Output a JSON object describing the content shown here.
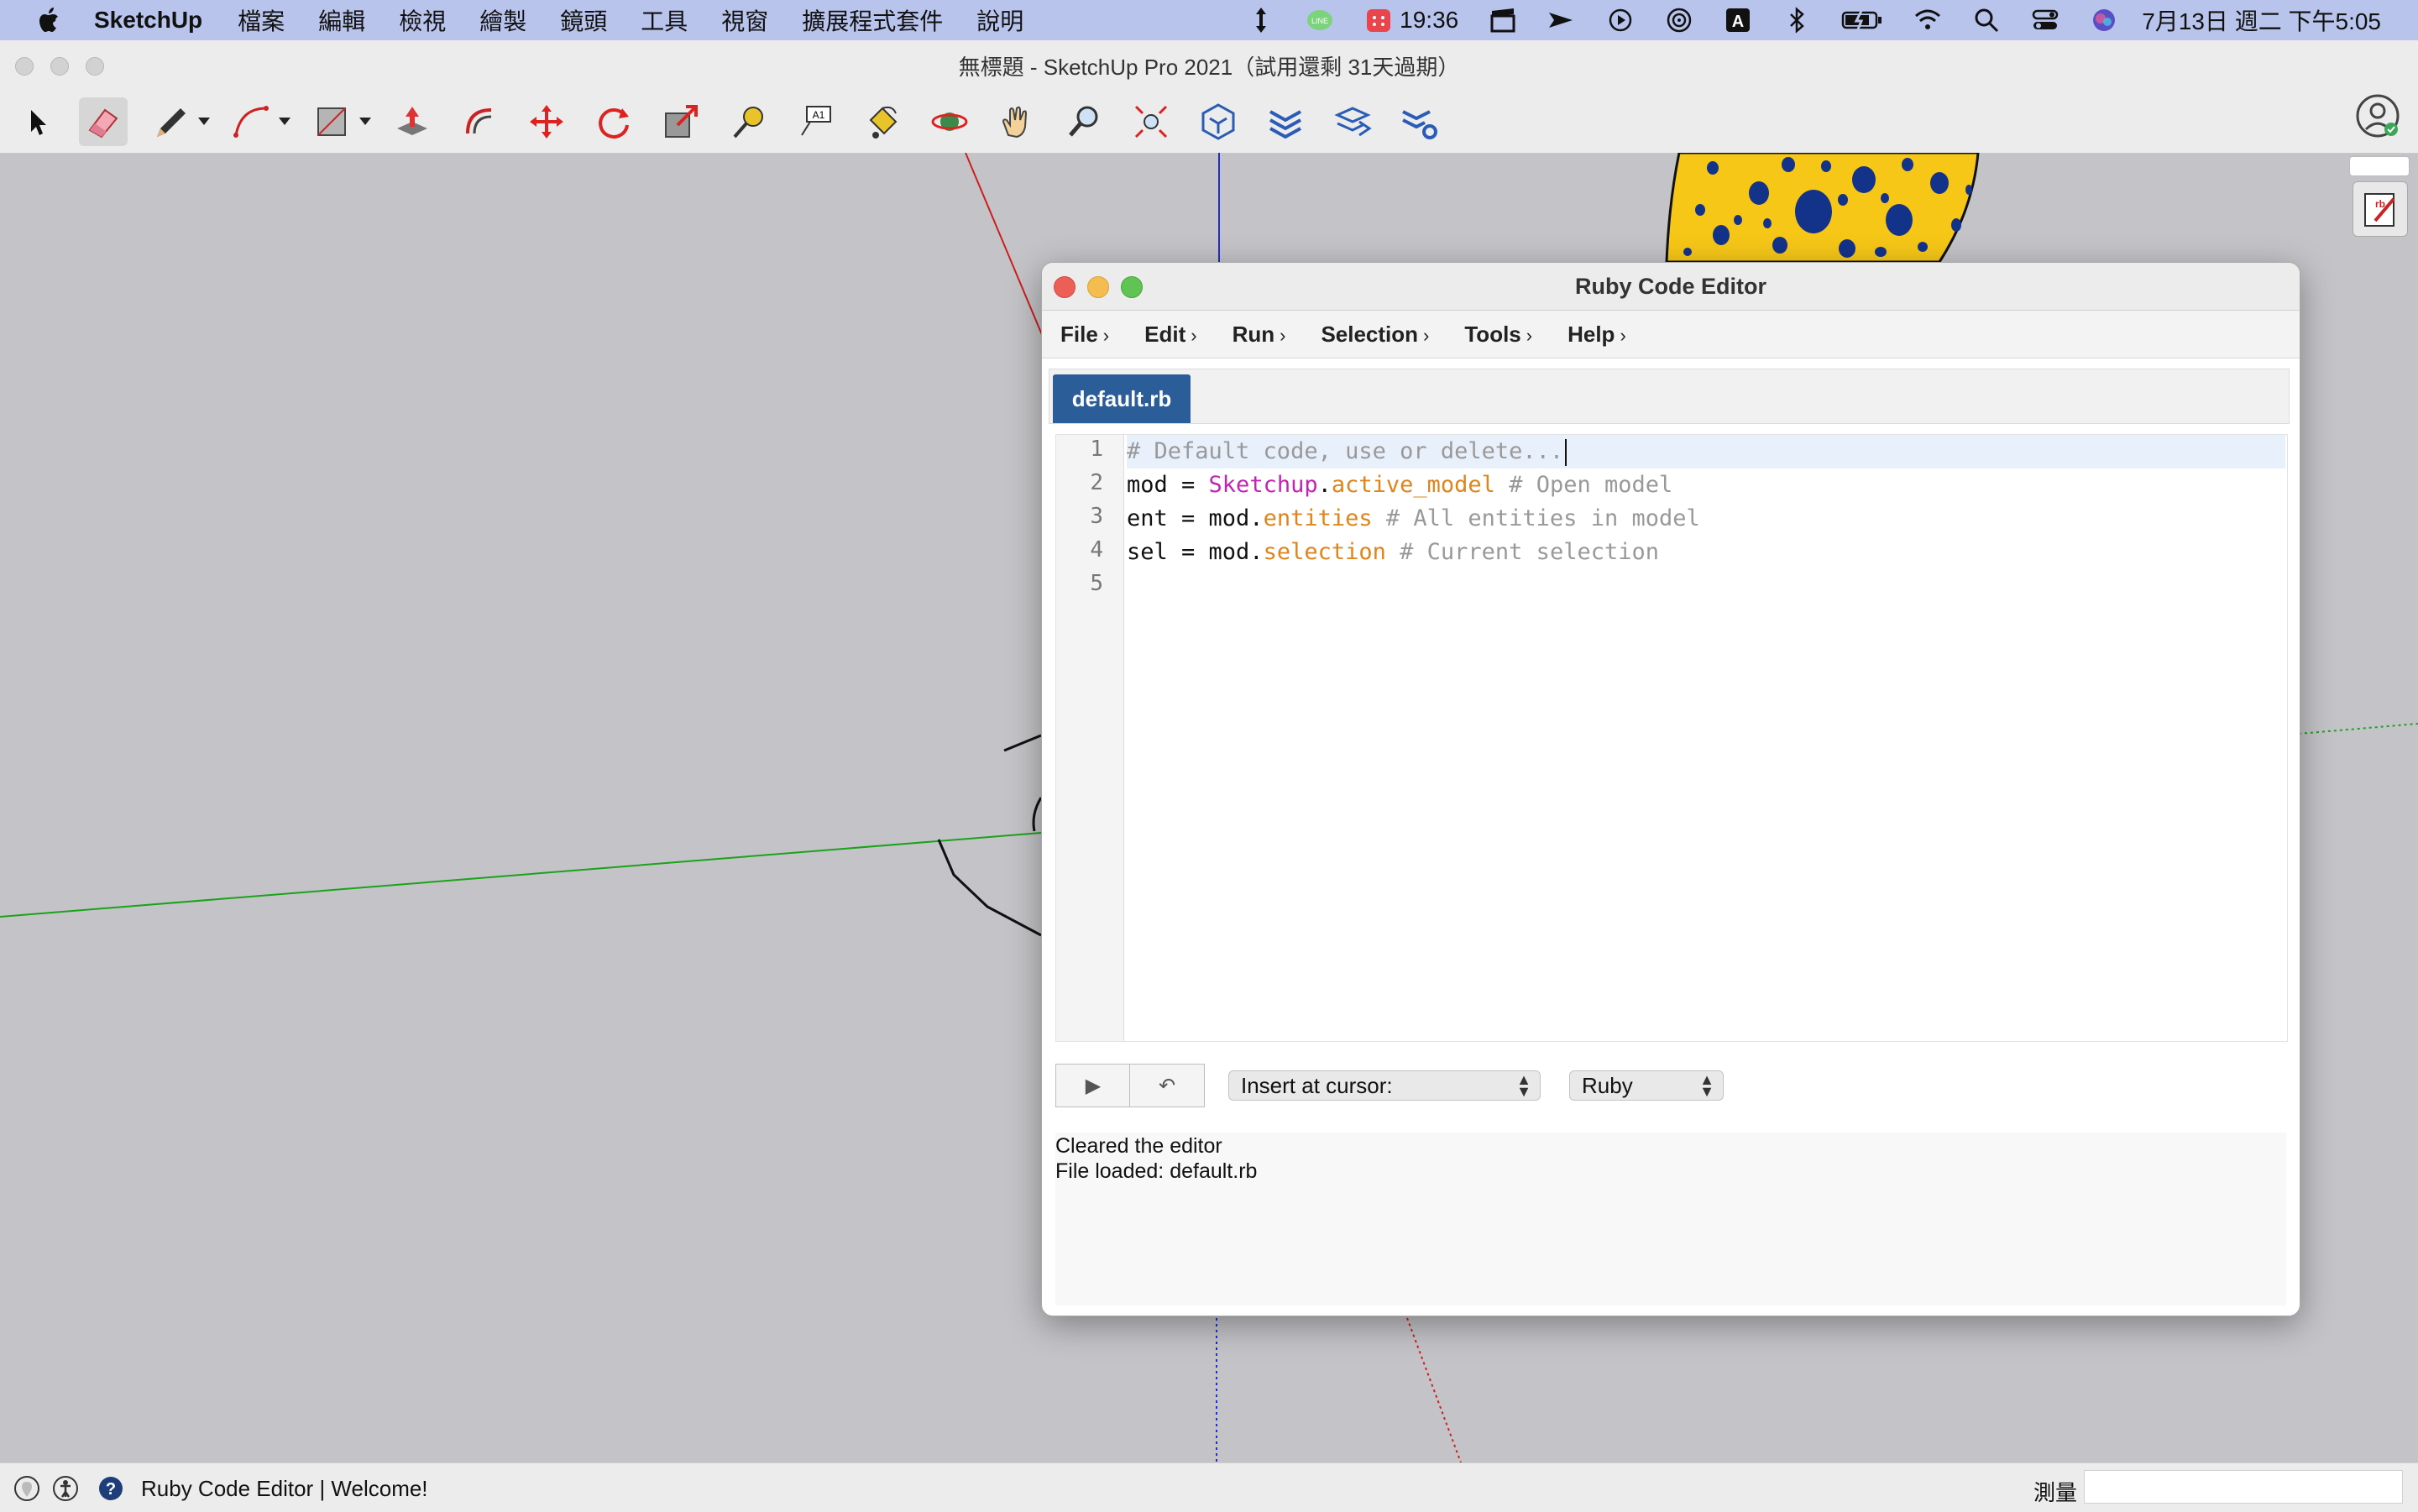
{
  "menubar": {
    "app_name": "SketchUp",
    "items": [
      "檔案",
      "編輯",
      "檢視",
      "繪製",
      "鏡頭",
      "工具",
      "視窗",
      "擴展程式套件",
      "說明"
    ],
    "status_time": "19:36",
    "clock": "7月13日 週二 下午5:05",
    "input_source": "A"
  },
  "window": {
    "title": "無標題 - SketchUp Pro 2021（試用還剩 31天過期）"
  },
  "toolbar": {
    "tools": [
      "select-icon",
      "eraser-icon",
      "pencil-line-icon",
      "arc-icon",
      "rectangle-icon",
      "push-pull-icon",
      "offset-icon",
      "move-icon",
      "rotate-icon",
      "scale-icon",
      "tape-measure-icon",
      "text-icon",
      "paint-bucket-icon",
      "orbit-icon",
      "pan-icon",
      "zoom-icon",
      "zoom-extents-icon",
      "warehouse-icon",
      "extension-warehouse-icon",
      "layout-icon",
      "extension-manager-icon"
    ],
    "active_tool": "eraser-icon"
  },
  "editor": {
    "title": "Ruby Code Editor",
    "menus": [
      "File",
      "Edit",
      "Run",
      "Selection",
      "Tools",
      "Help"
    ],
    "tab": "default.rb",
    "line_numbers": [
      "1",
      "2",
      "3",
      "4",
      "5"
    ],
    "code": {
      "line1": {
        "comment": "# Default code, use or delete..."
      },
      "line2": {
        "var": "mod = ",
        "const": "Sketchup",
        "dot": ".",
        "method": "active_model",
        "comment": " # Open model"
      },
      "line3": {
        "var": "ent = mod.",
        "method": "entities",
        "comment": " # All entities in model"
      },
      "line4": {
        "var": "sel = mod.",
        "method": "selection",
        "comment": " # Current selection"
      }
    },
    "run_button": "▶",
    "undo_button": "↶",
    "insert_select": "Insert at cursor:",
    "language_select": "Ruby",
    "output_lines": [
      "Cleared the editor",
      "File loaded: default.rb"
    ]
  },
  "statusbar": {
    "text": "Ruby Code Editor | Welcome!",
    "measure_label": "測量",
    "measure_value": ""
  },
  "colors": {
    "menubar_bg": "#b9c4ed",
    "tab_active": "#2b5d99",
    "code_constant": "#c324b4",
    "code_method": "#e0841b",
    "code_comment": "#999999",
    "axis_red": "#cc1f1f",
    "axis_green": "#1aa31a",
    "axis_blue": "#1f2fcc",
    "object_yellow": "#f6c717",
    "object_spots": "#13328a"
  }
}
